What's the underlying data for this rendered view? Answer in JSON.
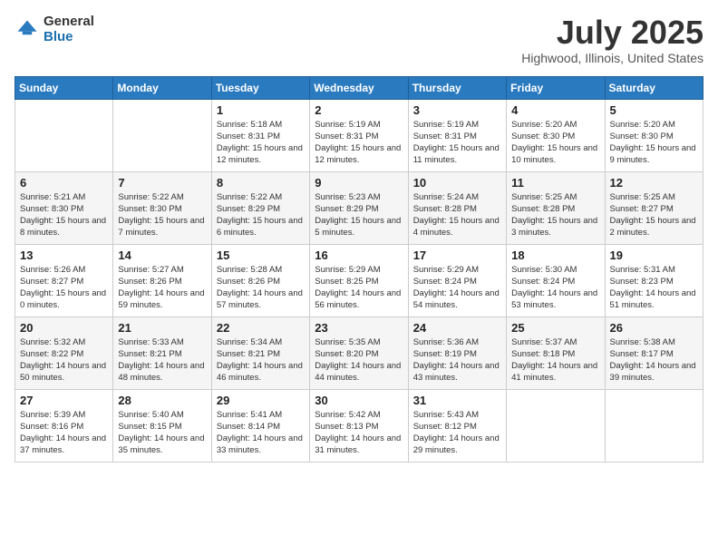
{
  "logo": {
    "general": "General",
    "blue": "Blue"
  },
  "title": "July 2025",
  "location": "Highwood, Illinois, United States",
  "days_of_week": [
    "Sunday",
    "Monday",
    "Tuesday",
    "Wednesday",
    "Thursday",
    "Friday",
    "Saturday"
  ],
  "weeks": [
    [
      {
        "day": "",
        "sunrise": "",
        "sunset": "",
        "daylight": ""
      },
      {
        "day": "",
        "sunrise": "",
        "sunset": "",
        "daylight": ""
      },
      {
        "day": "1",
        "sunrise": "Sunrise: 5:18 AM",
        "sunset": "Sunset: 8:31 PM",
        "daylight": "Daylight: 15 hours and 12 minutes."
      },
      {
        "day": "2",
        "sunrise": "Sunrise: 5:19 AM",
        "sunset": "Sunset: 8:31 PM",
        "daylight": "Daylight: 15 hours and 12 minutes."
      },
      {
        "day": "3",
        "sunrise": "Sunrise: 5:19 AM",
        "sunset": "Sunset: 8:31 PM",
        "daylight": "Daylight: 15 hours and 11 minutes."
      },
      {
        "day": "4",
        "sunrise": "Sunrise: 5:20 AM",
        "sunset": "Sunset: 8:30 PM",
        "daylight": "Daylight: 15 hours and 10 minutes."
      },
      {
        "day": "5",
        "sunrise": "Sunrise: 5:20 AM",
        "sunset": "Sunset: 8:30 PM",
        "daylight": "Daylight: 15 hours and 9 minutes."
      }
    ],
    [
      {
        "day": "6",
        "sunrise": "Sunrise: 5:21 AM",
        "sunset": "Sunset: 8:30 PM",
        "daylight": "Daylight: 15 hours and 8 minutes."
      },
      {
        "day": "7",
        "sunrise": "Sunrise: 5:22 AM",
        "sunset": "Sunset: 8:30 PM",
        "daylight": "Daylight: 15 hours and 7 minutes."
      },
      {
        "day": "8",
        "sunrise": "Sunrise: 5:22 AM",
        "sunset": "Sunset: 8:29 PM",
        "daylight": "Daylight: 15 hours and 6 minutes."
      },
      {
        "day": "9",
        "sunrise": "Sunrise: 5:23 AM",
        "sunset": "Sunset: 8:29 PM",
        "daylight": "Daylight: 15 hours and 5 minutes."
      },
      {
        "day": "10",
        "sunrise": "Sunrise: 5:24 AM",
        "sunset": "Sunset: 8:28 PM",
        "daylight": "Daylight: 15 hours and 4 minutes."
      },
      {
        "day": "11",
        "sunrise": "Sunrise: 5:25 AM",
        "sunset": "Sunset: 8:28 PM",
        "daylight": "Daylight: 15 hours and 3 minutes."
      },
      {
        "day": "12",
        "sunrise": "Sunrise: 5:25 AM",
        "sunset": "Sunset: 8:27 PM",
        "daylight": "Daylight: 15 hours and 2 minutes."
      }
    ],
    [
      {
        "day": "13",
        "sunrise": "Sunrise: 5:26 AM",
        "sunset": "Sunset: 8:27 PM",
        "daylight": "Daylight: 15 hours and 0 minutes."
      },
      {
        "day": "14",
        "sunrise": "Sunrise: 5:27 AM",
        "sunset": "Sunset: 8:26 PM",
        "daylight": "Daylight: 14 hours and 59 minutes."
      },
      {
        "day": "15",
        "sunrise": "Sunrise: 5:28 AM",
        "sunset": "Sunset: 8:26 PM",
        "daylight": "Daylight: 14 hours and 57 minutes."
      },
      {
        "day": "16",
        "sunrise": "Sunrise: 5:29 AM",
        "sunset": "Sunset: 8:25 PM",
        "daylight": "Daylight: 14 hours and 56 minutes."
      },
      {
        "day": "17",
        "sunrise": "Sunrise: 5:29 AM",
        "sunset": "Sunset: 8:24 PM",
        "daylight": "Daylight: 14 hours and 54 minutes."
      },
      {
        "day": "18",
        "sunrise": "Sunrise: 5:30 AM",
        "sunset": "Sunset: 8:24 PM",
        "daylight": "Daylight: 14 hours and 53 minutes."
      },
      {
        "day": "19",
        "sunrise": "Sunrise: 5:31 AM",
        "sunset": "Sunset: 8:23 PM",
        "daylight": "Daylight: 14 hours and 51 minutes."
      }
    ],
    [
      {
        "day": "20",
        "sunrise": "Sunrise: 5:32 AM",
        "sunset": "Sunset: 8:22 PM",
        "daylight": "Daylight: 14 hours and 50 minutes."
      },
      {
        "day": "21",
        "sunrise": "Sunrise: 5:33 AM",
        "sunset": "Sunset: 8:21 PM",
        "daylight": "Daylight: 14 hours and 48 minutes."
      },
      {
        "day": "22",
        "sunrise": "Sunrise: 5:34 AM",
        "sunset": "Sunset: 8:21 PM",
        "daylight": "Daylight: 14 hours and 46 minutes."
      },
      {
        "day": "23",
        "sunrise": "Sunrise: 5:35 AM",
        "sunset": "Sunset: 8:20 PM",
        "daylight": "Daylight: 14 hours and 44 minutes."
      },
      {
        "day": "24",
        "sunrise": "Sunrise: 5:36 AM",
        "sunset": "Sunset: 8:19 PM",
        "daylight": "Daylight: 14 hours and 43 minutes."
      },
      {
        "day": "25",
        "sunrise": "Sunrise: 5:37 AM",
        "sunset": "Sunset: 8:18 PM",
        "daylight": "Daylight: 14 hours and 41 minutes."
      },
      {
        "day": "26",
        "sunrise": "Sunrise: 5:38 AM",
        "sunset": "Sunset: 8:17 PM",
        "daylight": "Daylight: 14 hours and 39 minutes."
      }
    ],
    [
      {
        "day": "27",
        "sunrise": "Sunrise: 5:39 AM",
        "sunset": "Sunset: 8:16 PM",
        "daylight": "Daylight: 14 hours and 37 minutes."
      },
      {
        "day": "28",
        "sunrise": "Sunrise: 5:40 AM",
        "sunset": "Sunset: 8:15 PM",
        "daylight": "Daylight: 14 hours and 35 minutes."
      },
      {
        "day": "29",
        "sunrise": "Sunrise: 5:41 AM",
        "sunset": "Sunset: 8:14 PM",
        "daylight": "Daylight: 14 hours and 33 minutes."
      },
      {
        "day": "30",
        "sunrise": "Sunrise: 5:42 AM",
        "sunset": "Sunset: 8:13 PM",
        "daylight": "Daylight: 14 hours and 31 minutes."
      },
      {
        "day": "31",
        "sunrise": "Sunrise: 5:43 AM",
        "sunset": "Sunset: 8:12 PM",
        "daylight": "Daylight: 14 hours and 29 minutes."
      },
      {
        "day": "",
        "sunrise": "",
        "sunset": "",
        "daylight": ""
      },
      {
        "day": "",
        "sunrise": "",
        "sunset": "",
        "daylight": ""
      }
    ]
  ]
}
